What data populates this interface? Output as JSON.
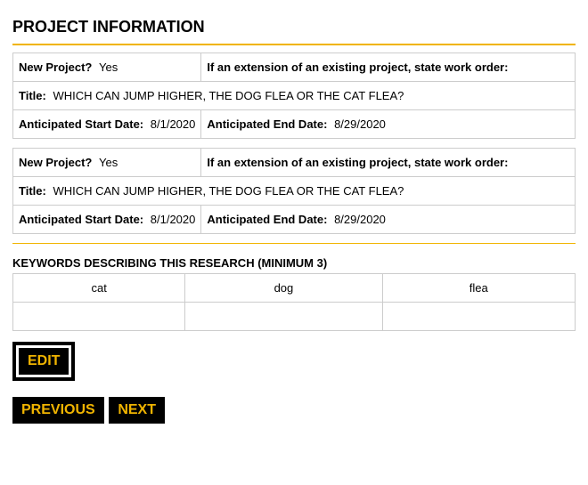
{
  "section_title": "PROJECT INFORMATION",
  "rows": {
    "new_project_label": "New Project?",
    "new_project_value": "Yes",
    "extension_label": "If an extension of an existing project, state work order:",
    "title_label": "Title:",
    "title_value": "WHICH CAN JUMP HIGHER, THE DOG FLEA OR THE CAT FLEA?",
    "start_label": "Anticipated Start Date:",
    "start_value": "8/1/2020",
    "end_label": "Anticipated End Date:",
    "end_value": "8/29/2020"
  },
  "keywords_header": "KEYWORDS DESCRIBING THIS RESEARCH (MINIMUM 3)",
  "keywords": [
    "cat",
    "dog",
    "flea"
  ],
  "buttons": {
    "edit": "EDIT",
    "previous": "PREVIOUS",
    "next": "NEXT"
  }
}
